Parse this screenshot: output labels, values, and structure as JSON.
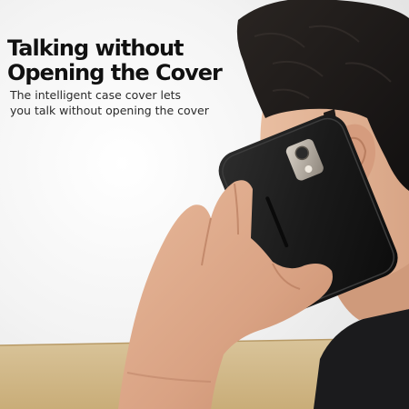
{
  "caption": {
    "title_line1": "Talking without",
    "title_line2": "Opening the Cover",
    "subtitle_line1": "The intelligent case cover lets",
    "subtitle_line2": "you talk without opening the cover"
  }
}
